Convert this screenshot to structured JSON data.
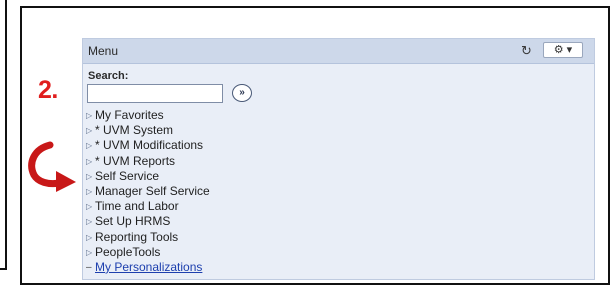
{
  "annotation": {
    "step_label": "2.",
    "accent_color": "#e01e1e"
  },
  "menu": {
    "title": "Menu",
    "refresh_icon": "refresh-icon",
    "options_icon": "gear-icon",
    "options_glyph": "⚙ ▾",
    "search_label": "Search:",
    "search_value": "",
    "search_go_glyph": "»",
    "items": [
      {
        "label": "My Favorites",
        "icon": "expand-triangle-icon"
      },
      {
        "label": "* UVM System",
        "icon": "expand-triangle-icon"
      },
      {
        "label": "* UVM Modifications",
        "icon": "expand-triangle-icon"
      },
      {
        "label": "* UVM Reports",
        "icon": "expand-triangle-icon"
      },
      {
        "label": "Self Service",
        "icon": "expand-triangle-icon"
      },
      {
        "label": "Manager Self Service",
        "icon": "expand-triangle-icon"
      },
      {
        "label": "Time and Labor",
        "icon": "expand-triangle-icon"
      },
      {
        "label": "Set Up HRMS",
        "icon": "expand-triangle-icon"
      },
      {
        "label": "Reporting Tools",
        "icon": "expand-triangle-icon"
      },
      {
        "label": "PeopleTools",
        "icon": "expand-triangle-icon"
      }
    ],
    "personalizations_link": "My Personalizations"
  }
}
